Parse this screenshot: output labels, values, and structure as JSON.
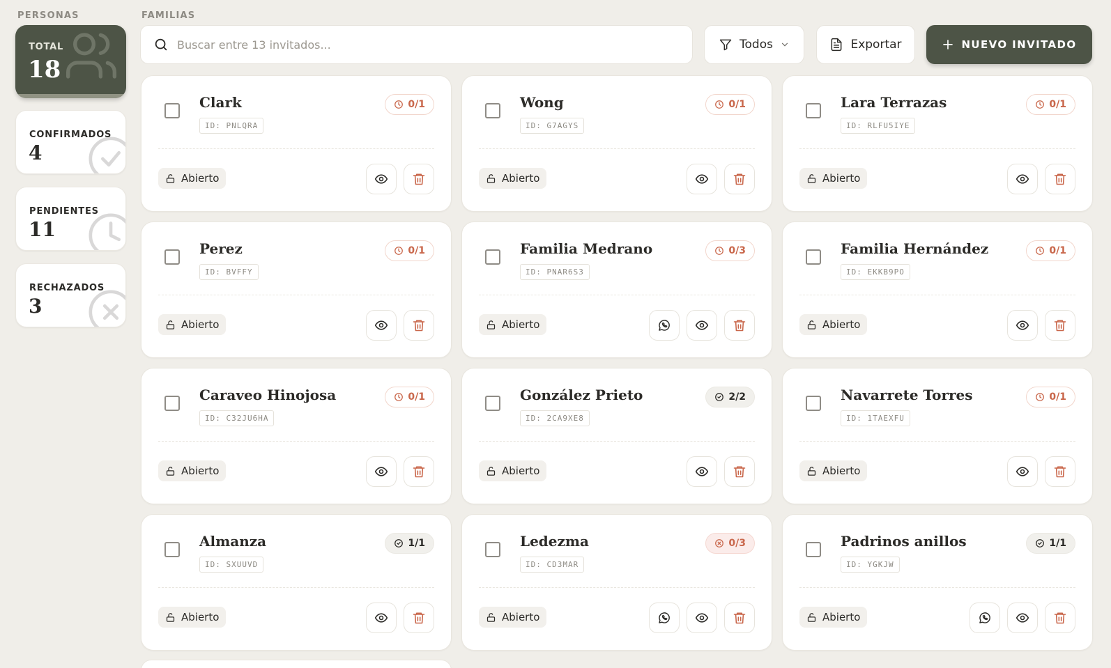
{
  "sidebar": {
    "section_label": "PERSONAS",
    "stats": {
      "total": {
        "label": "TOTAL",
        "value": "18"
      },
      "confirmed": {
        "label": "CONFIRMADOS",
        "value": "4"
      },
      "pending": {
        "label": "PENDIENTES",
        "value": "11"
      },
      "rejected": {
        "label": "RECHAZADOS",
        "value": "3"
      }
    }
  },
  "main": {
    "section_label": "FAMILIAS",
    "search": {
      "placeholder": "Buscar entre 13 invitados...",
      "value": ""
    },
    "filter": {
      "label": "Todos"
    },
    "export": {
      "label": "Exportar"
    },
    "new_guest": {
      "label": "NUEVO INVITADO"
    }
  },
  "colors": {
    "accent": "#4d5446",
    "pending": "#c9674b",
    "background": "#f0eee9"
  },
  "icons": {
    "search": "search-icon",
    "filter": "filter-icon",
    "export": "file-icon",
    "new": "plus-icon",
    "view": "eye-icon",
    "delete": "trash-icon",
    "whatsapp": "whatsapp-icon",
    "lock": "unlock-icon"
  },
  "cards": [
    {
      "name": "Clark",
      "id": "ID: PNLQRA",
      "badge": "0/1",
      "badge_type": "pending",
      "status": "Abierto",
      "whatsapp": false
    },
    {
      "name": "Wong",
      "id": "ID: G7AGYS",
      "badge": "0/1",
      "badge_type": "pending",
      "status": "Abierto",
      "whatsapp": false
    },
    {
      "name": "Lara Terrazas",
      "id": "ID: RLFU5IYE",
      "badge": "0/1",
      "badge_type": "pending",
      "status": "Abierto",
      "whatsapp": false
    },
    {
      "name": "Perez",
      "id": "ID: BVFFY",
      "badge": "0/1",
      "badge_type": "pending",
      "status": "Abierto",
      "whatsapp": false
    },
    {
      "name": "Familia Medrano",
      "id": "ID: PNAR6S3",
      "badge": "0/3",
      "badge_type": "pending",
      "status": "Abierto",
      "whatsapp": true
    },
    {
      "name": "Familia Hernández",
      "id": "ID: EKKB9PO",
      "badge": "0/1",
      "badge_type": "pending",
      "status": "Abierto",
      "whatsapp": false
    },
    {
      "name": "Caraveo Hinojosa",
      "id": "ID: C32JU6HA",
      "badge": "0/1",
      "badge_type": "pending",
      "status": "Abierto",
      "whatsapp": false
    },
    {
      "name": "González Prieto",
      "id": "ID: 2CA9XE8",
      "badge": "2/2",
      "badge_type": "confirmed",
      "status": "Abierto",
      "whatsapp": false
    },
    {
      "name": "Navarrete Torres",
      "id": "ID: 1TAEXFU",
      "badge": "0/1",
      "badge_type": "pending",
      "status": "Abierto",
      "whatsapp": false
    },
    {
      "name": "Almanza",
      "id": "ID: SXUUVD",
      "badge": "1/1",
      "badge_type": "confirmed",
      "status": "Abierto",
      "whatsapp": false
    },
    {
      "name": "Ledezma",
      "id": "ID: CD3MAR",
      "badge": "0/3",
      "badge_type": "rejected",
      "status": "Abierto",
      "whatsapp": true
    },
    {
      "name": "Padrinos anillos",
      "id": "ID: YGKJW",
      "badge": "1/1",
      "badge_type": "confirmed",
      "status": "Abierto",
      "whatsapp": true
    }
  ]
}
